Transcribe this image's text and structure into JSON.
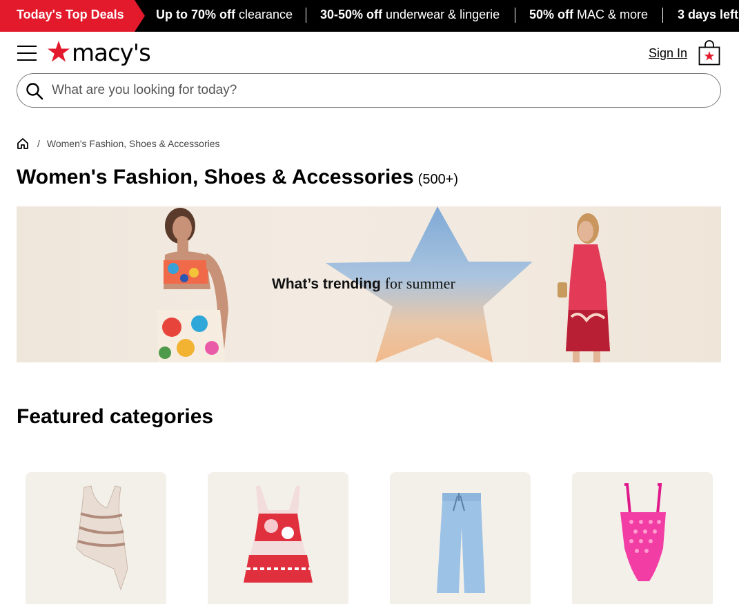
{
  "promo": {
    "deal_label": "Today's Top Deals",
    "items": [
      {
        "bold": "Up to 70% off",
        "rest": " clearance"
      },
      {
        "bold": "30-50% off",
        "rest": " underwear & lingerie"
      },
      {
        "bold": "50% off",
        "rest": " MAC & more"
      },
      {
        "bold": "3 days left",
        "rest": ""
      }
    ]
  },
  "header": {
    "logo_text": "macy's",
    "sign_in": "Sign In"
  },
  "search": {
    "placeholder": "What are you looking for today?"
  },
  "breadcrumb": {
    "separator": "/",
    "current": "Women's Fashion, Shoes & Accessories"
  },
  "page": {
    "title": "Women's Fashion, Shoes & Accessories",
    "count": "(500+)"
  },
  "banner": {
    "text_bold": "What’s trending",
    "text_rest": "for summer"
  },
  "featured": {
    "title": "Featured categories",
    "cards": [
      "halter-top",
      "floral-dress",
      "denim-pants",
      "pink-swimsuit"
    ]
  },
  "colors": {
    "brand_red": "#e21a2c",
    "promo_bg": "#000000"
  }
}
